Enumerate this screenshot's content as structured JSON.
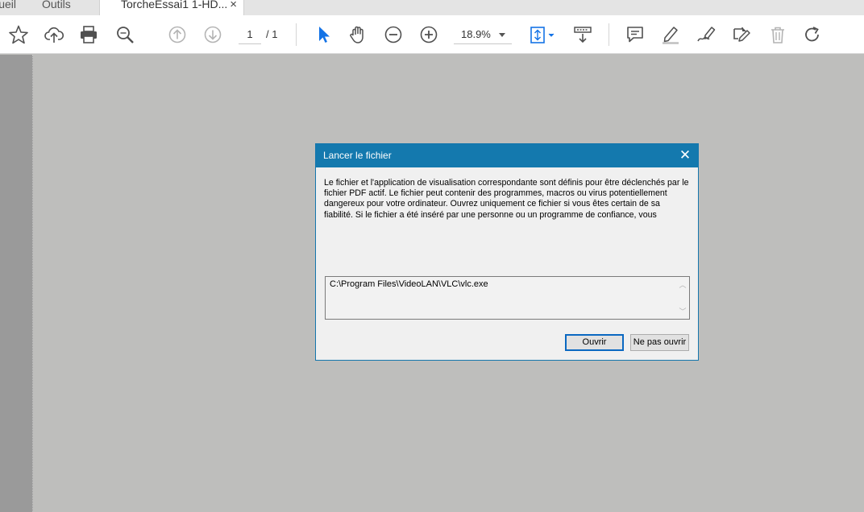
{
  "tabs": {
    "home_label": "Accueil",
    "tools_label": "Outils",
    "doc_label": "TorcheEssai1 1-HD...",
    "doc_close": "×"
  },
  "toolbar": {
    "icons": [
      "star-icon",
      "cloud-upload-icon",
      "print-icon",
      "search-zoom-icon",
      "arrow-up-circle-icon",
      "arrow-down-circle-icon",
      "select-cursor-icon",
      "hand-icon",
      "zoom-out-icon",
      "zoom-in-icon",
      "fit-page-icon",
      "scroll-mode-icon",
      "comment-icon",
      "highlight-icon",
      "sign-icon",
      "edit-doc-icon",
      "trash-icon",
      "rotate-icon"
    ],
    "page_current": "1",
    "page_total": "/ 1",
    "zoom": "18.9%",
    "accent_color": "#1473e6"
  },
  "dialog": {
    "title": "Lancer le fichier",
    "close_glyph": "✕",
    "message": "Le fichier et l'application de visualisation correspondante sont définis pour être déclenchés par le fichier PDF actif. Le fichier peut contenir des programmes, macros ou virus potentiellement dangereux pour votre ordinateur. Ouvrez uniquement ce fichier si vous êtes certain de sa fiabilité. Si le fichier a été inséré par une personne ou un programme de confiance, vous",
    "path": "C:\\Program Files\\VideoLAN\\VLC\\vlc.exe",
    "open_label": "Ouvrir",
    "cancel_label": "Ne pas ouvrir",
    "title_color": "#1479ae"
  }
}
